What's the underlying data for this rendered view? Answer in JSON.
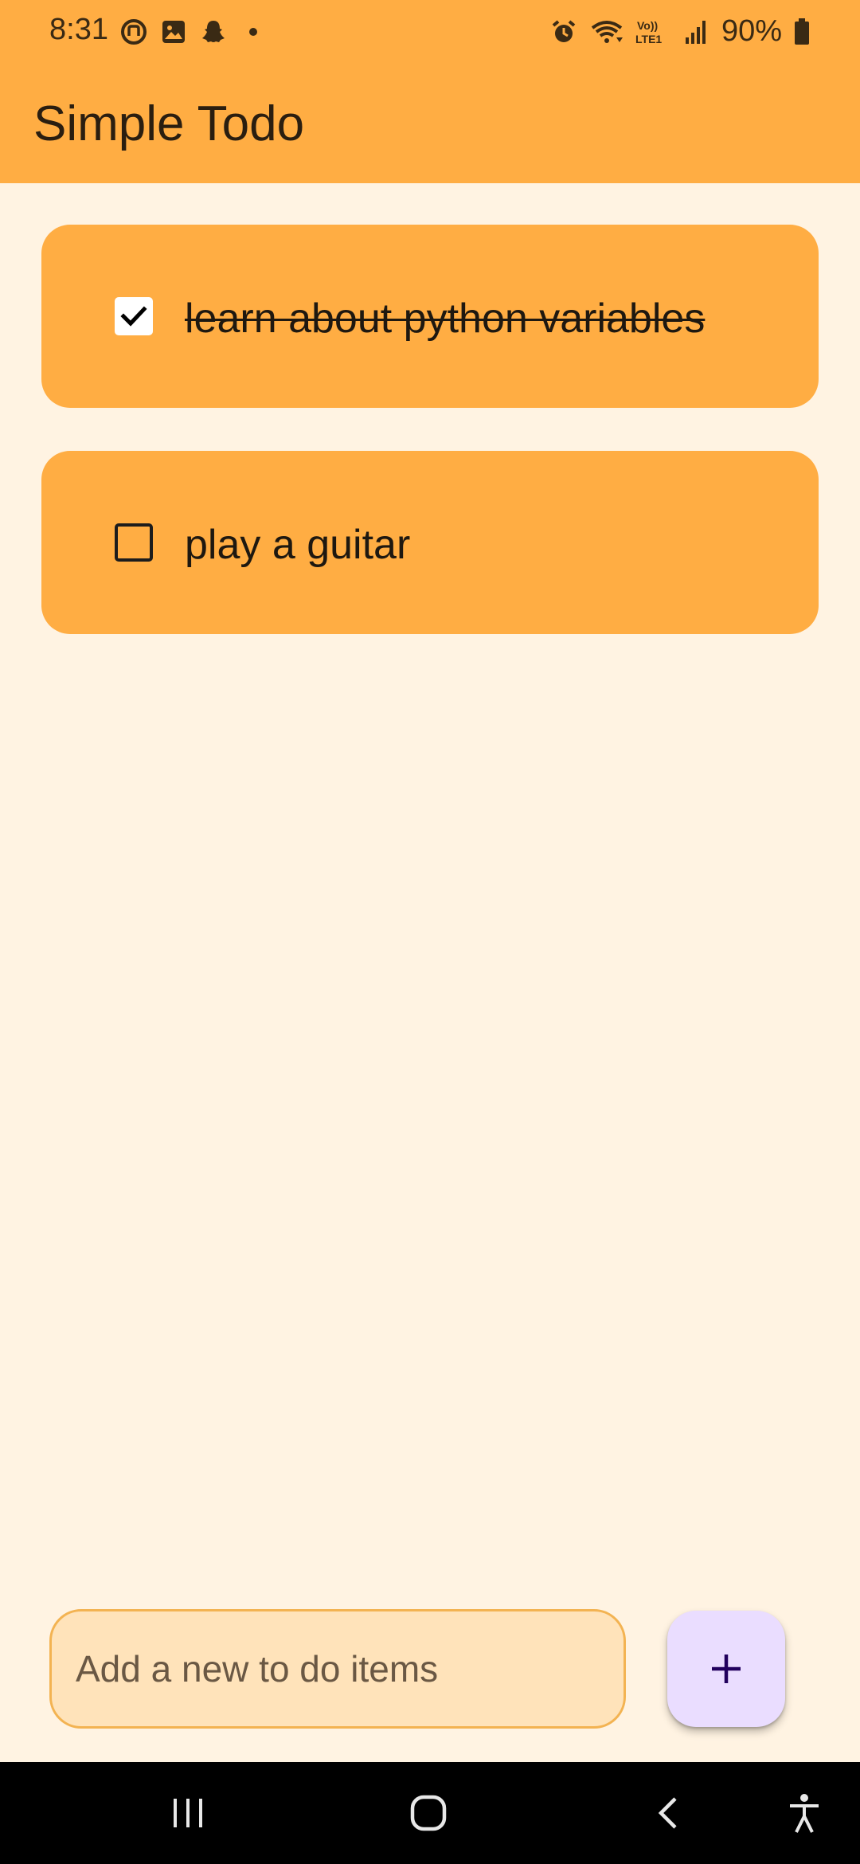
{
  "status_bar": {
    "time": "8:31",
    "left_icons": [
      "sync-icon",
      "gallery-icon",
      "snapchat-icon",
      "dot-icon"
    ],
    "right_icons": [
      "alarm-icon",
      "wifi-icon",
      "volte-icon",
      "signal-icon",
      "battery-icon"
    ],
    "volte_text": "Vo)) LTE1",
    "battery_percent": "90%"
  },
  "app_bar": {
    "title": "Simple Todo"
  },
  "todos": [
    {
      "label": "learn about python variables",
      "checked": true
    },
    {
      "label": "play a guitar",
      "checked": false
    }
  ],
  "new_item": {
    "placeholder": "Add a new to do items",
    "value": ""
  },
  "add_button": {
    "icon": "plus-icon"
  },
  "nav_bar": {
    "buttons": [
      "recents-icon",
      "home-icon",
      "back-icon",
      "accessibility-icon"
    ]
  },
  "colors": {
    "accent": "#FFAD43",
    "background": "#FFF3E2",
    "input_fill": "#FFE3BA",
    "fab_fill": "#EADDFF",
    "fab_icon": "#21005D"
  }
}
